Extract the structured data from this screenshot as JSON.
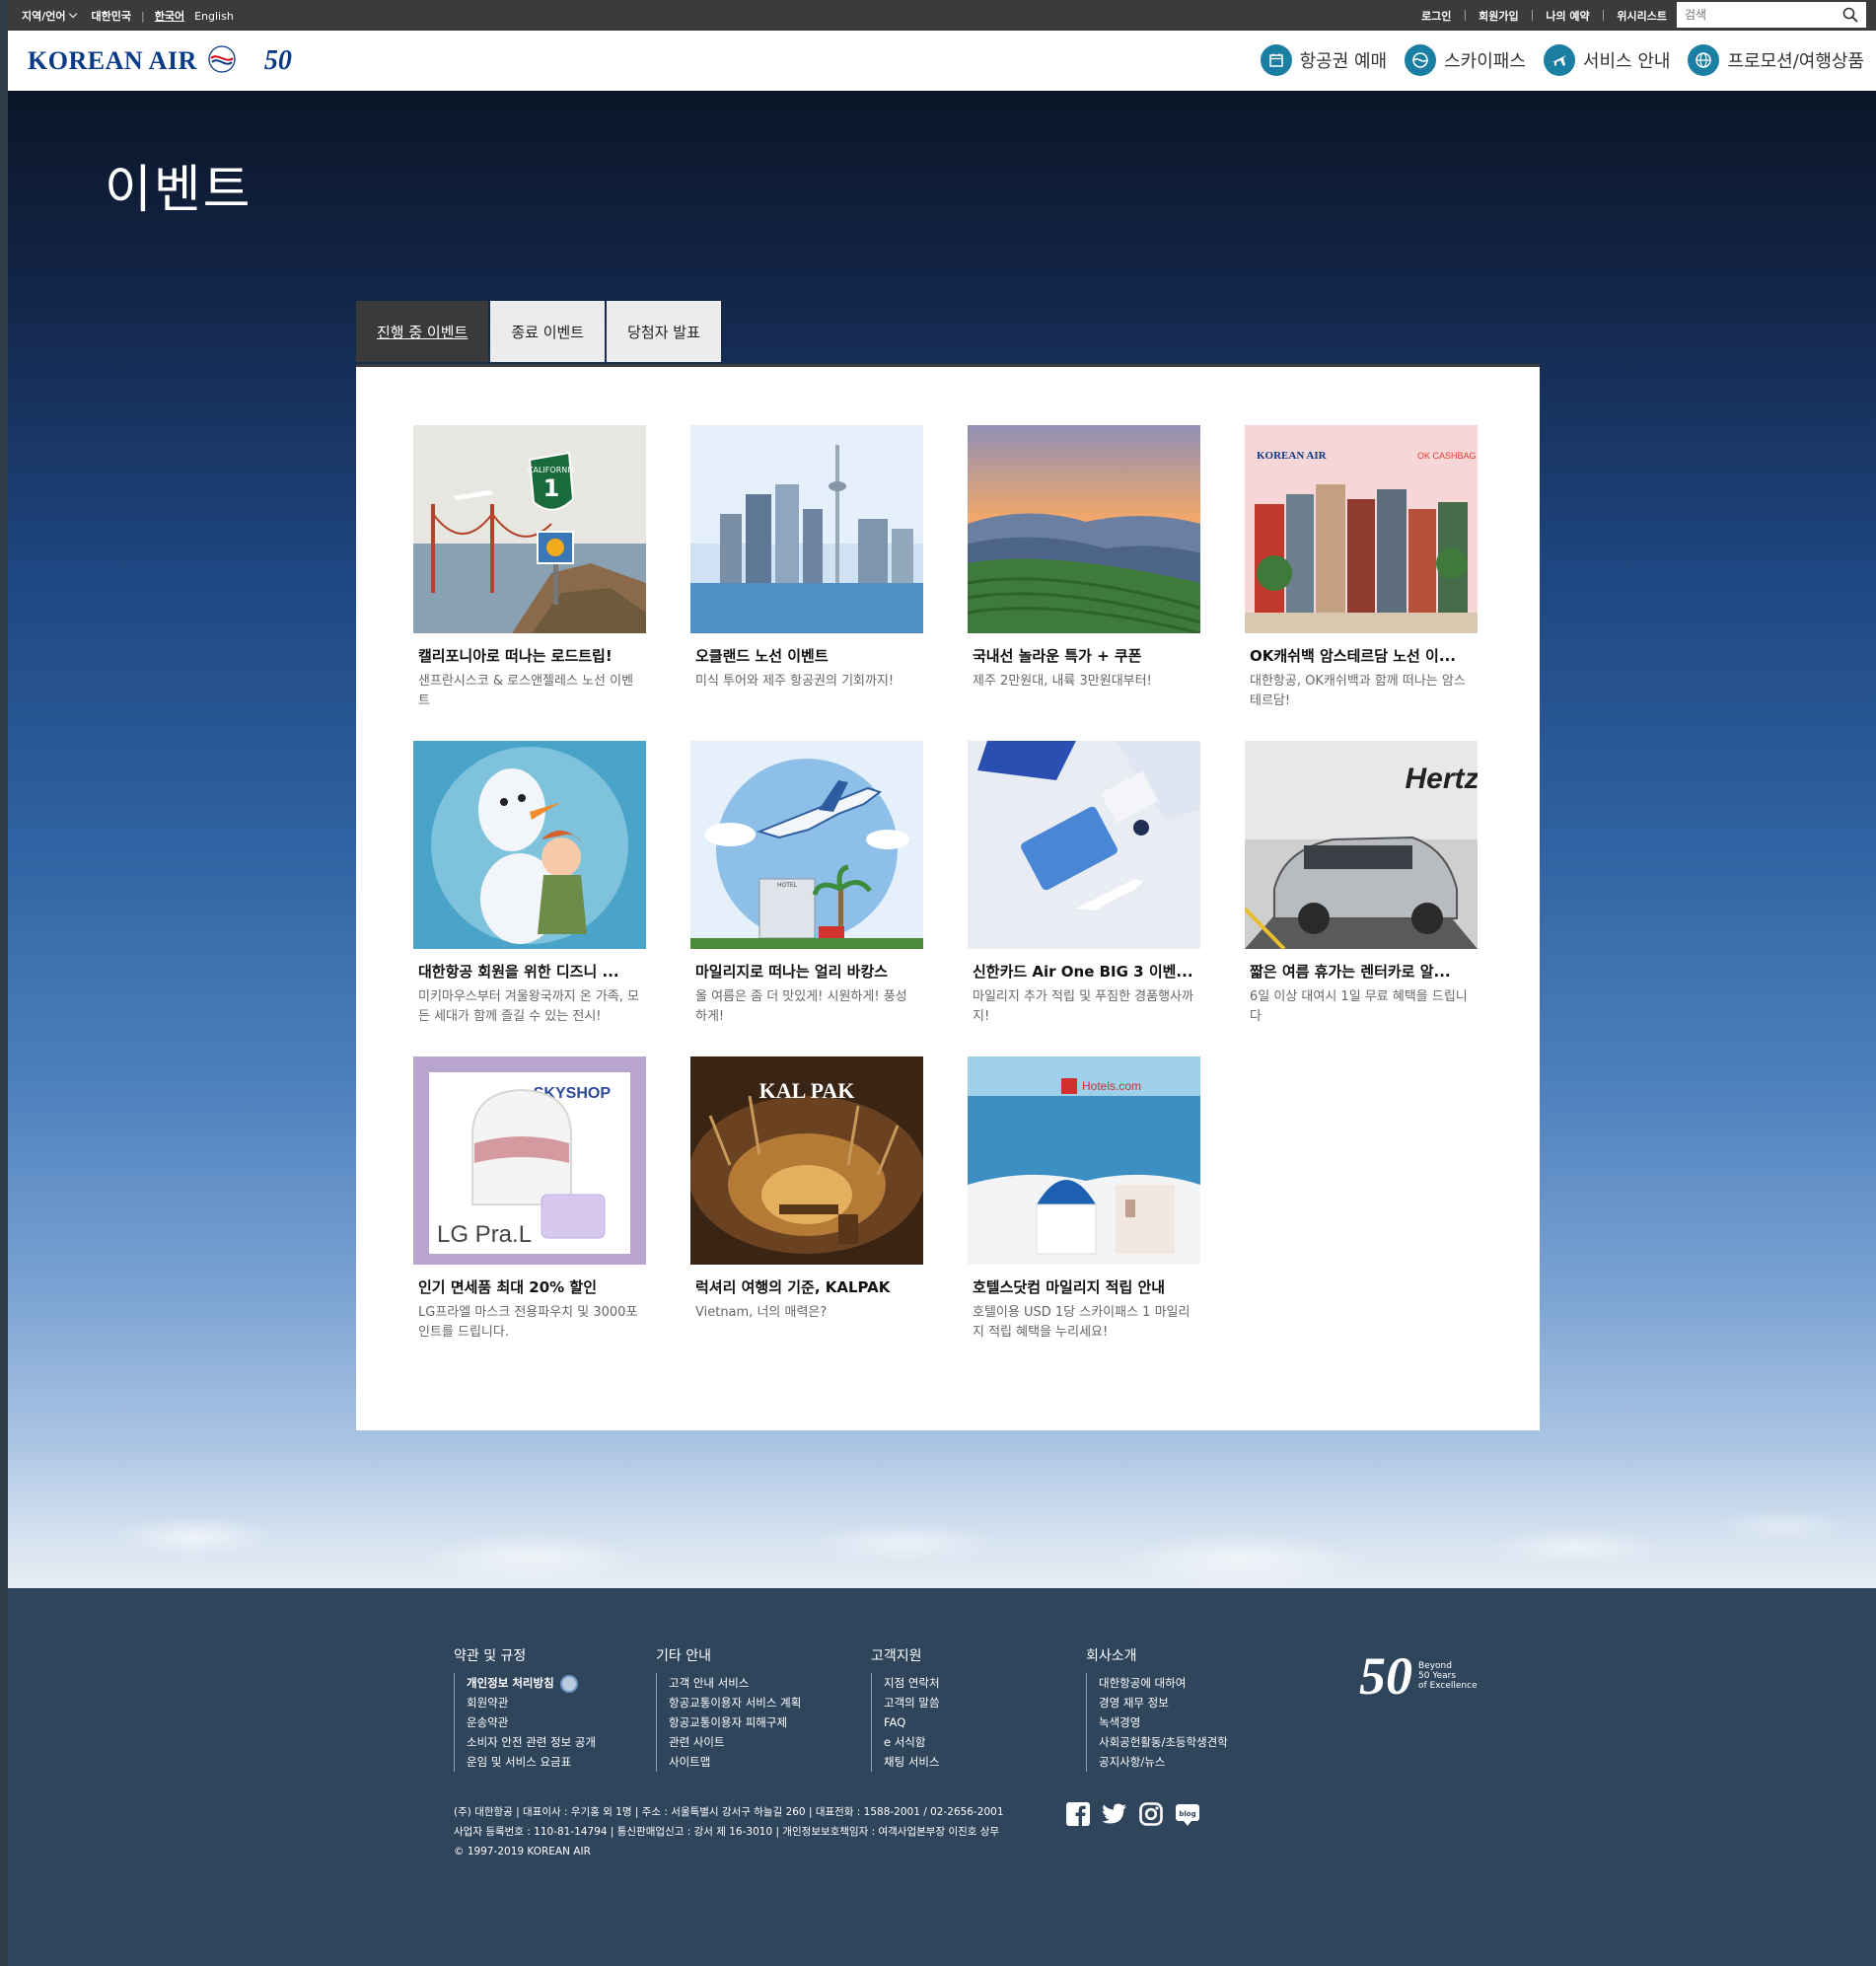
{
  "utilbar": {
    "region": "지역/언어",
    "country": "대한민국",
    "lang_ko": "한국어",
    "lang_en": "English",
    "links": [
      "로그인",
      "회원가입",
      "나의 예약",
      "위시리스트"
    ],
    "search_placeholder": "검색"
  },
  "header": {
    "logo": "KOREAN AIR",
    "anniv": "50",
    "nav": [
      {
        "label": "항공권 예매",
        "icon": "calendar-icon"
      },
      {
        "label": "스카이패스",
        "icon": "skypass-icon"
      },
      {
        "label": "서비스 안내",
        "icon": "plane-icon"
      },
      {
        "label": "프로모션/여행상품",
        "icon": "globe-icon"
      }
    ]
  },
  "page": {
    "title": "이벤트"
  },
  "tabs": [
    "진행 중 이벤트",
    "종료 이벤트",
    "당첨자 발표"
  ],
  "cards": [
    {
      "title": "캘리포니아로 떠나는 로드트립!",
      "desc": "샌프란시스코 & 로스앤젤레스 노선 이벤트"
    },
    {
      "title": "오클랜드 노선 이벤트",
      "desc": "미식 투어와 제주 항공권의 기회까지!"
    },
    {
      "title": "국내선 놀라운 특가 + 쿠폰",
      "desc": "제주 2만원대, 내륙 3만원대부터!"
    },
    {
      "title": "OK캐쉬백 암스테르담 노선 이...",
      "desc": "대한항공, OK캐쉬백과 함께 떠나는 암스테르담!"
    },
    {
      "title": "대한항공 회원을 위한 디즈니 ...",
      "desc": "미키마우스부터 겨울왕국까지 온 가족, 모든 세대가 함께 즐길 수 있는 전시!"
    },
    {
      "title": "마일리지로 떠나는 얼리 바캉스",
      "desc": "올 여름은 좀 더 맛있게! 시원하게! 풍성하게!"
    },
    {
      "title": "신한카드 Air One BIG 3 이벤...",
      "desc": "마일리지 추가 적립 및 푸짐한 경품행사까지!"
    },
    {
      "title": "짧은 여름 휴가는 렌터카로 알...",
      "desc": "6일 이상 대여시 1일 무료 혜택을 드립니다"
    },
    {
      "title": "인기 면세품 최대 20% 할인",
      "desc": "LG프라엘 마스크 전용파우치 및 3000포인트를 드립니다."
    },
    {
      "title": "럭셔리 여행의 기준, KALPAK",
      "desc": "Vietnam, 너의 매력은?"
    },
    {
      "title": "호텔스닷컴 마일리지 적립 안내",
      "desc": "호텔이용 USD 1당 스카이패스 1 마일리지 적립 혜택을 누리세요!"
    }
  ],
  "thumb_text": {
    "california": "CALIFORNIA",
    "route": "1",
    "okcashbag": "OK CASHBAG",
    "hertz": "Hertz",
    "skyshop": "SKYSHOP",
    "lgpral": "LG Pra.L",
    "kalpak": "KAL PAK",
    "hotels": "Hotels.com",
    "hotel_sign": "HOTEL"
  },
  "footer": {
    "cols": [
      {
        "title": "약관 및 규정",
        "items": [
          "개인정보 처리방침",
          "회원약관",
          "운송약관",
          "소비자 안전 관련 정보 공개",
          "운임 및 서비스 요금표"
        ]
      },
      {
        "title": "기타 안내",
        "items": [
          "고객 안내 서비스",
          "항공교통이용자 서비스 계획",
          "항공교통이용자 피해구제",
          "관련 사이트",
          "사이트맵"
        ]
      },
      {
        "title": "고객지원",
        "items": [
          "지점 연락처",
          "고객의 말씀",
          "FAQ",
          "e 서식함",
          "채팅 서비스"
        ]
      },
      {
        "title": "회사소개",
        "items": [
          "대한항공에 대하여",
          "경영 재무 정보",
          "녹색경영",
          "사회공헌활동/초등학생견학",
          "공지사항/뉴스"
        ]
      }
    ],
    "info": [
      "(주) 대한항공 | 대표이사 : 우기홍 외 1명 | 주소 : 서울특별시 강서구 하늘길 260 | 대표전화 : 1588-2001 / 02-2656-2001",
      "사업자 등록번호 : 110-81-14794 | 통신판매업신고 : 강서 제 16-3010 | 개인정보보호책임자 : 여객사업본부장 이진호 상무",
      "© 1997-2019 KOREAN AIR"
    ],
    "anniv_num": "50",
    "anniv_tag": [
      "Beyond",
      "50 Years",
      "of Excellence"
    ],
    "social": [
      "facebook-icon",
      "twitter-icon",
      "instagram-icon",
      "blog-icon"
    ],
    "blog_label": "blog"
  }
}
